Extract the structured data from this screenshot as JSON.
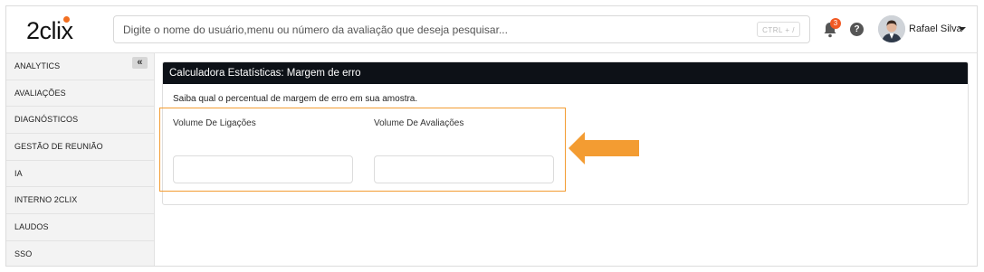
{
  "header": {
    "logo_text": "2clix",
    "search_placeholder": "Digite o nome do usuário,menu ou número da avaliação que deseja pesquisar...",
    "shortcut_hint": "CTRL + /",
    "notification_count": "3",
    "help_label": "?",
    "user_name": "Rafael Silva"
  },
  "sidebar": {
    "collapse_label": "«",
    "items": [
      {
        "label": "ANALYTICS"
      },
      {
        "label": "AVALIAÇÕES"
      },
      {
        "label": "DIAGNÓSTICOS"
      },
      {
        "label": "GESTÃO DE REUNIÃO"
      },
      {
        "label": "IA"
      },
      {
        "label": "INTERNO 2CLIX"
      },
      {
        "label": "LAUDOS"
      },
      {
        "label": "SSO"
      }
    ]
  },
  "panel": {
    "title": "Calculadora Estatísticas: Margem de erro",
    "description": "Saiba qual o percentual de margem de erro em sua amostra.",
    "field1_label": "Volume De Ligações",
    "field1_value": "",
    "field2_label": "Volume De Avaliações",
    "field2_value": ""
  },
  "colors": {
    "accent": "#f39c32",
    "panel_header": "#0d1117",
    "badge": "#f15a24",
    "logo_dot": "#f26f21"
  },
  "icons": {
    "bell": "bell-icon",
    "help": "help-icon",
    "caret": "chevron-down-icon",
    "annotation": "arrow-left-icon"
  }
}
